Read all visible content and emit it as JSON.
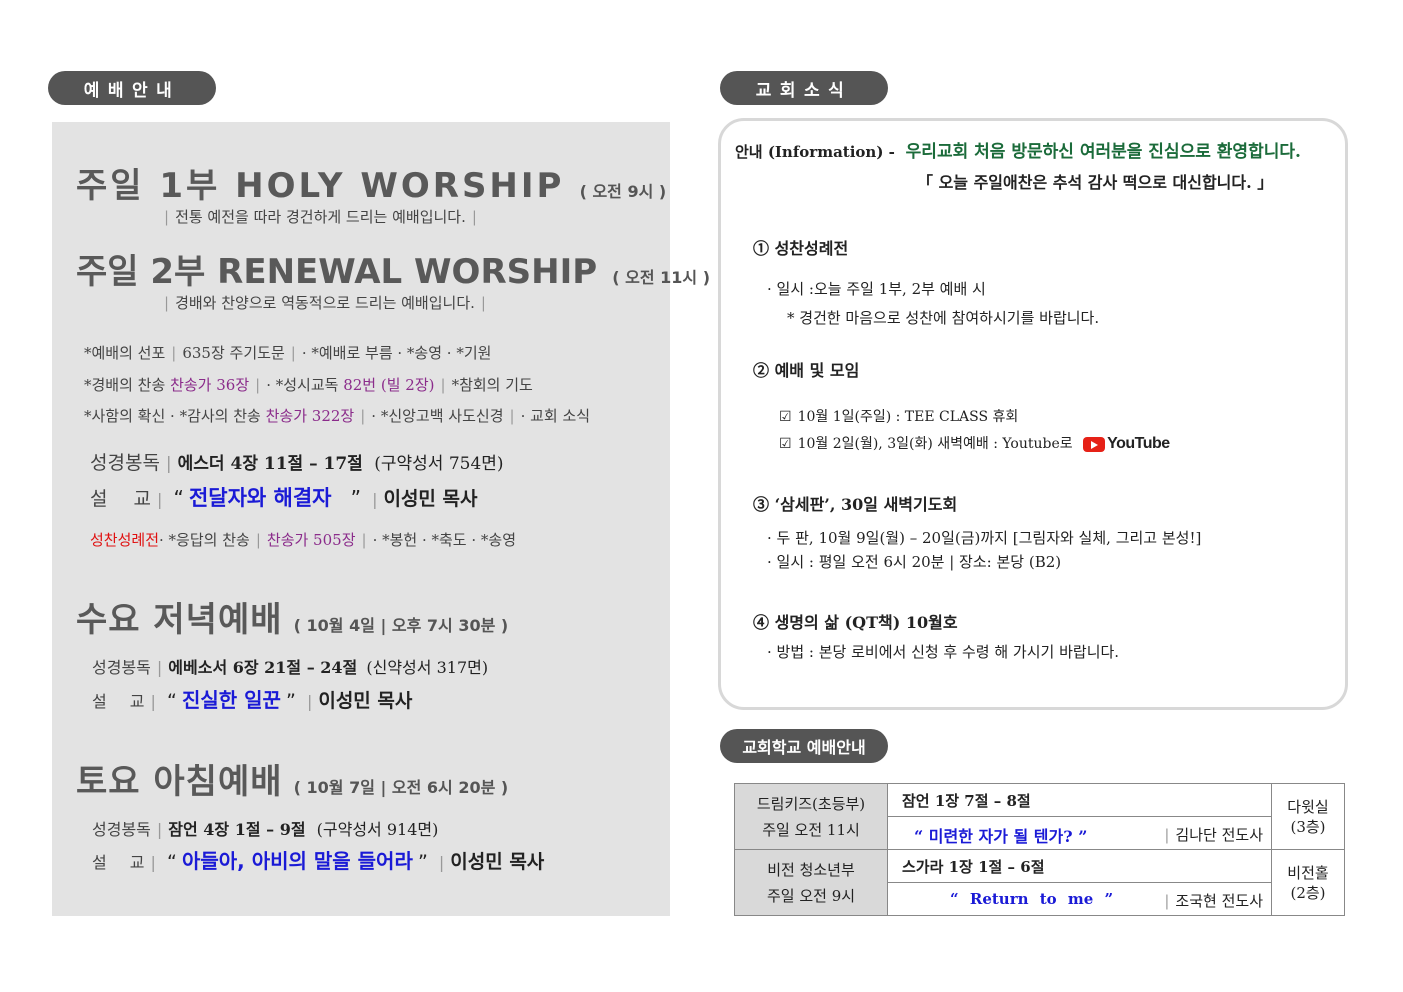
{
  "left": {
    "header": "예배안내",
    "sunday1": {
      "title": "주일 1부 HOLY WORSHIP",
      "time": "( 오전 9시 )",
      "desc": "전통 예전을 따라 경건하게 드리는 예배입니다."
    },
    "sunday2": {
      "title": "주일 2부 RENEWAL WORSHIP",
      "time": "( 오전 11시 )",
      "desc": "경배와 찬양으로 역동적으로 드리는 예배입니다."
    },
    "order": {
      "l1a": "*예배의 선포",
      "l1b": "635장 주기도문",
      "l1c": "· *예배로 부름 · *송영 · *기원",
      "l2a": "*경배의 찬송",
      "l2b": "찬송가 36장",
      "l2c": "· *성시교독",
      "l2d": "82번 (빌 2장)",
      "l2e": "*참회의 기도",
      "l3a": "*사함의 확신 · *감사의 찬송",
      "l3b": "찬송가 322장",
      "l3c": "· *신앙고백 사도신경",
      "l3d": "· 교회 소식"
    },
    "scripture_label": "성경봉독",
    "scripture": "에스더 4장 11절 – 17절",
    "scripture_note": "(구약성서 754면)",
    "sermon_label": "설 교",
    "sermon_title": "전달자와 해결자",
    "preacher": "이성민 목사",
    "after": {
      "a": "성찬성례전",
      "b": "· *응답의 찬송",
      "c": "찬송가 505장",
      "d": "· *봉헌 · *축도 · *송영"
    },
    "wednesday": {
      "title": "수요 저녁예배",
      "time": "( 10월 4일 | 오후 7시 30분 )",
      "scripture_label": "성경봉독",
      "scripture": "에베소서 6장 21절 – 24절",
      "scripture_note": "(신약성서 317면)",
      "sermon_label": "설 교",
      "sermon_title": "진실한 일꾼",
      "preacher": "이성민 목사"
    },
    "saturday": {
      "title": "토요 아침예배",
      "time": "( 10월 7일 | 오전 6시 20분 )",
      "scripture_label": "성경봉독",
      "scripture": "잠언 4장 1절 – 9절",
      "scripture_note": "(구약성서 914면)",
      "sermon_label": "설 교",
      "sermon_title": "아들아, 아비의 말을 들어라",
      "preacher": "이성민 목사"
    }
  },
  "news": {
    "header": "교회소식",
    "intro_label": "안내 (Information) -",
    "intro_text": "우리교회 처음 방문하신 여러분을 진심으로 환영합니다.",
    "intro_sub": "「 오늘 주일애찬은 추석 감사 떡으로 대신합니다. 」",
    "item1": {
      "title": "① 성찬성례전",
      "l1": "· 일시 :오늘 주일 1부, 2부 예배 시",
      "l2": "* 경건한 마음으로 성찬에 참여하시기를 바랍니다."
    },
    "item2": {
      "title": "② 예배 및 모임",
      "c1": "10월 1일(주일) : TEE CLASS 휴회",
      "c2": "10월 2일(월), 3일(화) 새벽예배 : Youtube로",
      "yt": "YouTube"
    },
    "item3": {
      "title": "③ ‘삼세판’, 30일 새벽기도회",
      "l1": "· 두 판, 10월 9일(월) – 20일(금)까지 [그림자와 실체, 그리고 본성!]",
      "l2": "· 일시 : 평일 오전 6시 20분 | 장소: 본당 (B2)"
    },
    "item4": {
      "title": "④ 생명의 삶 (QT책) 10월호",
      "l1": "· 방법 : 본당 로비에서 신청 후 수령 해 가시기 바랍니다."
    }
  },
  "school": {
    "header": "교회학교 예배안내",
    "rows": [
      {
        "group": "드림키즈(초등부)",
        "time": "주일 오전 11시",
        "scripture": "잠언 1장 7절 – 8절",
        "sermon": "“ 미련한 자가 될 텐가? ”",
        "preacher": "김나단 전도사",
        "room": "다윗실",
        "floor": "(3층)"
      },
      {
        "group": "비전 청소년부",
        "time": "주일 오전 9시",
        "scripture": "스가라 1장 1절 – 6절",
        "sermon": "“ Return to me ”",
        "preacher": "조국현 전도사",
        "room": "비전홀",
        "floor": "(2층)"
      }
    ]
  }
}
